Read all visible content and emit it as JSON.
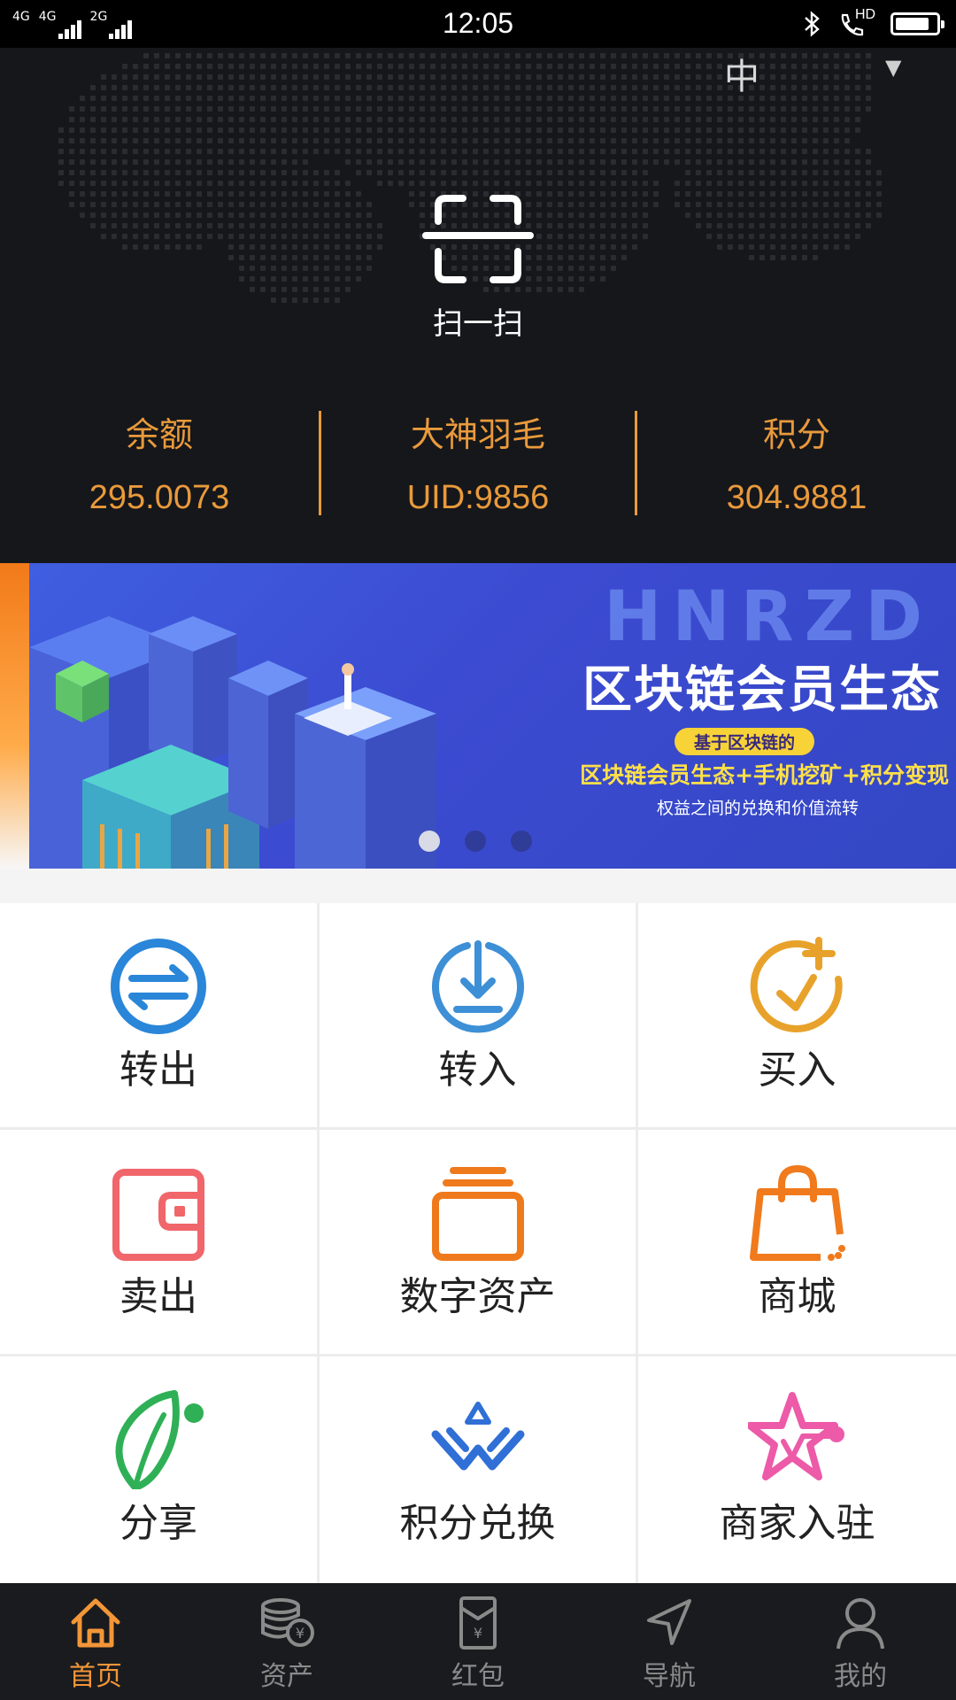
{
  "status_bar": {
    "network_1": "4G",
    "network_2": "4G",
    "network_3": "2G",
    "time": "12:05",
    "hd_label": "HD",
    "battery_level": 0.85
  },
  "header": {
    "language": "中",
    "scan_label": "扫一扫",
    "stats": [
      {
        "title": "余额",
        "value": "295.0073"
      },
      {
        "title": "大神羽毛",
        "value": "UID:9856"
      },
      {
        "title": "积分",
        "value": "304.9881"
      }
    ]
  },
  "banner": {
    "brand": "HNRZD",
    "headline": "区块链会员生态",
    "pill": "基于区块链的",
    "subline": "区块链会员生态+手机挖矿+积分变现",
    "caption": "权益之间的兑换和价值流转",
    "slides": 3,
    "active_slide": 1
  },
  "menu": [
    {
      "label": "转出",
      "icon": "transfer-out-icon",
      "color": "#2a86d8"
    },
    {
      "label": "转入",
      "icon": "transfer-in-icon",
      "color": "#3d8fd6"
    },
    {
      "label": "买入",
      "icon": "buy-icon",
      "color": "#e8a22b"
    },
    {
      "label": "卖出",
      "icon": "wallet-icon",
      "color": "#f0666a"
    },
    {
      "label": "数字资产",
      "icon": "digital-assets-icon",
      "color": "#ef7a1c"
    },
    {
      "label": "商城",
      "icon": "shopping-bag-icon",
      "color": "#f07a1c"
    },
    {
      "label": "分享",
      "icon": "leaf-icon",
      "color": "#2fb056"
    },
    {
      "label": "积分兑换",
      "icon": "exchange-icon",
      "color": "#2f6fd6"
    },
    {
      "label": "商家入驻",
      "icon": "star-icon",
      "color": "#ec5aa8"
    }
  ],
  "bottom_nav": [
    {
      "label": "首页",
      "icon": "home-icon",
      "active": true
    },
    {
      "label": "资产",
      "icon": "coins-icon",
      "active": false
    },
    {
      "label": "红包",
      "icon": "red-envelope-icon",
      "active": false
    },
    {
      "label": "导航",
      "icon": "navigation-icon",
      "active": false
    },
    {
      "label": "我的",
      "icon": "profile-icon",
      "active": false
    }
  ],
  "colors": {
    "accent": "#e99a3b",
    "header_bg": "#16171b",
    "nav_active": "#f29638",
    "nav_inactive": "#8a8a8a"
  }
}
